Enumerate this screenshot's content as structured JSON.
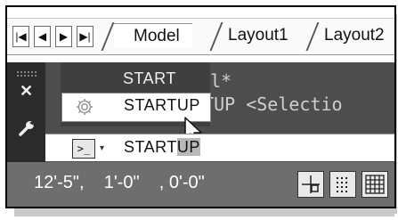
{
  "tabs": {
    "nav_first": "|◀",
    "nav_prev": "◀",
    "nav_next": "▶",
    "nav_last": "▶|",
    "items": [
      {
        "label": "Model"
      },
      {
        "label": "Layout1"
      },
      {
        "label": "Layout2"
      }
    ]
  },
  "command_history": {
    "line1": "ncel*",
    "line2": "RTUP <Selectio"
  },
  "autocomplete": {
    "header": "START",
    "item_label": "STARTUP"
  },
  "command_input": {
    "typed": "START",
    "suggested": "UP",
    "dropdown_arrow": "▾",
    "prompt_glyph": ">_"
  },
  "statusbar": {
    "coordinates": "12'-5\",    1'-0\"    , 0'-0\""
  },
  "icons": {
    "close": "close-icon",
    "wrench": "wrench-icon",
    "gear": "gear-icon",
    "cursor": "mouse-cursor-icon",
    "snap": "snap-icon",
    "grid": "grid-icon"
  },
  "colors": {
    "command_bg": "#4d4d4d",
    "left_panel_bg": "#2b2b2b",
    "statusbar_bg": "#6e6e6e"
  }
}
